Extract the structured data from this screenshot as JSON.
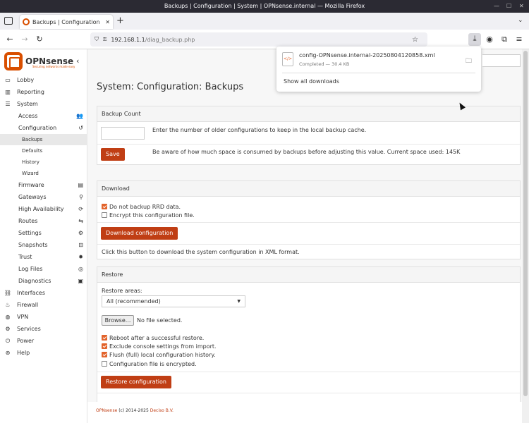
{
  "window": {
    "title": "Backups | Configuration | System | OPNsense.internal — Mozilla Firefox"
  },
  "tab": {
    "title": "Backups | Configuration | Sys",
    "new_tab": "+"
  },
  "nav": {
    "url_host": "192.168.1.1",
    "url_path": "/diag_backup.php"
  },
  "download": {
    "filename": "config-OPNsense.internal-20250804120858.xml",
    "status": "Completed — 30.4 KB",
    "show_all": "Show all downloads"
  },
  "logo": {
    "name": "OPNsense",
    "tagline": "Securing networks made easy"
  },
  "sidebar": {
    "items": [
      {
        "label": "Lobby",
        "icon": "laptop-icon"
      },
      {
        "label": "Reporting",
        "icon": "chart-icon"
      },
      {
        "label": "System",
        "icon": "server-icon"
      },
      {
        "label": "Access",
        "icon": "users-icon"
      },
      {
        "label": "Configuration",
        "icon": "history-icon"
      },
      {
        "label": "Backups"
      },
      {
        "label": "Defaults"
      },
      {
        "label": "History"
      },
      {
        "label": "Wizard"
      },
      {
        "label": "Firmware",
        "icon": "list-icon"
      },
      {
        "label": "Gateways",
        "icon": "location-icon"
      },
      {
        "label": "High Availability",
        "icon": "refresh-icon"
      },
      {
        "label": "Routes",
        "icon": "map-signs-icon"
      },
      {
        "label": "Settings",
        "icon": "cogs-icon"
      },
      {
        "label": "Snapshots",
        "icon": "hdd-icon"
      },
      {
        "label": "Trust",
        "icon": "certificate-icon"
      },
      {
        "label": "Log Files",
        "icon": "eye-icon"
      },
      {
        "label": "Diagnostics",
        "icon": "medkit-icon"
      },
      {
        "label": "Interfaces",
        "icon": "sitemap-icon"
      },
      {
        "label": "Firewall",
        "icon": "fire-icon"
      },
      {
        "label": "VPN",
        "icon": "globe-icon"
      },
      {
        "label": "Services",
        "icon": "cog-icon"
      },
      {
        "label": "Power",
        "icon": "plug-icon"
      },
      {
        "label": "Help",
        "icon": "life-ring-icon"
      }
    ]
  },
  "page": {
    "title": "System: Configuration: Backups"
  },
  "backup_count": {
    "header": "Backup Count",
    "input_value": "",
    "description": "Enter the number of older configurations to keep in the local backup cache.",
    "save": "Save",
    "note": "Be aware of how much space is consumed by backups before adjusting this value. Current space used: 145K"
  },
  "download_panel": {
    "header": "Download",
    "no_rrd": "Do not backup RRD data.",
    "encrypt": "Encrypt this configuration file.",
    "button": "Download configuration",
    "help": "Click this button to download the system configuration in XML format."
  },
  "restore": {
    "header": "Restore",
    "areas_label": "Restore areas:",
    "areas_value": "All (recommended)",
    "browse": "Browse...",
    "file_status": "No file selected.",
    "reboot": "Reboot after a successful restore.",
    "exclude_console": "Exclude console settings from import.",
    "flush_history": "Flush (full) local configuration history.",
    "encrypted": "Configuration file is encrypted.",
    "button": "Restore configuration"
  },
  "footer": {
    "brand": "OPNsense",
    "copyright": "(c) 2014-2025",
    "vendor": "Deciso B.V."
  },
  "colors": {
    "accent": "#c03e14",
    "brand": "#d94f00"
  }
}
